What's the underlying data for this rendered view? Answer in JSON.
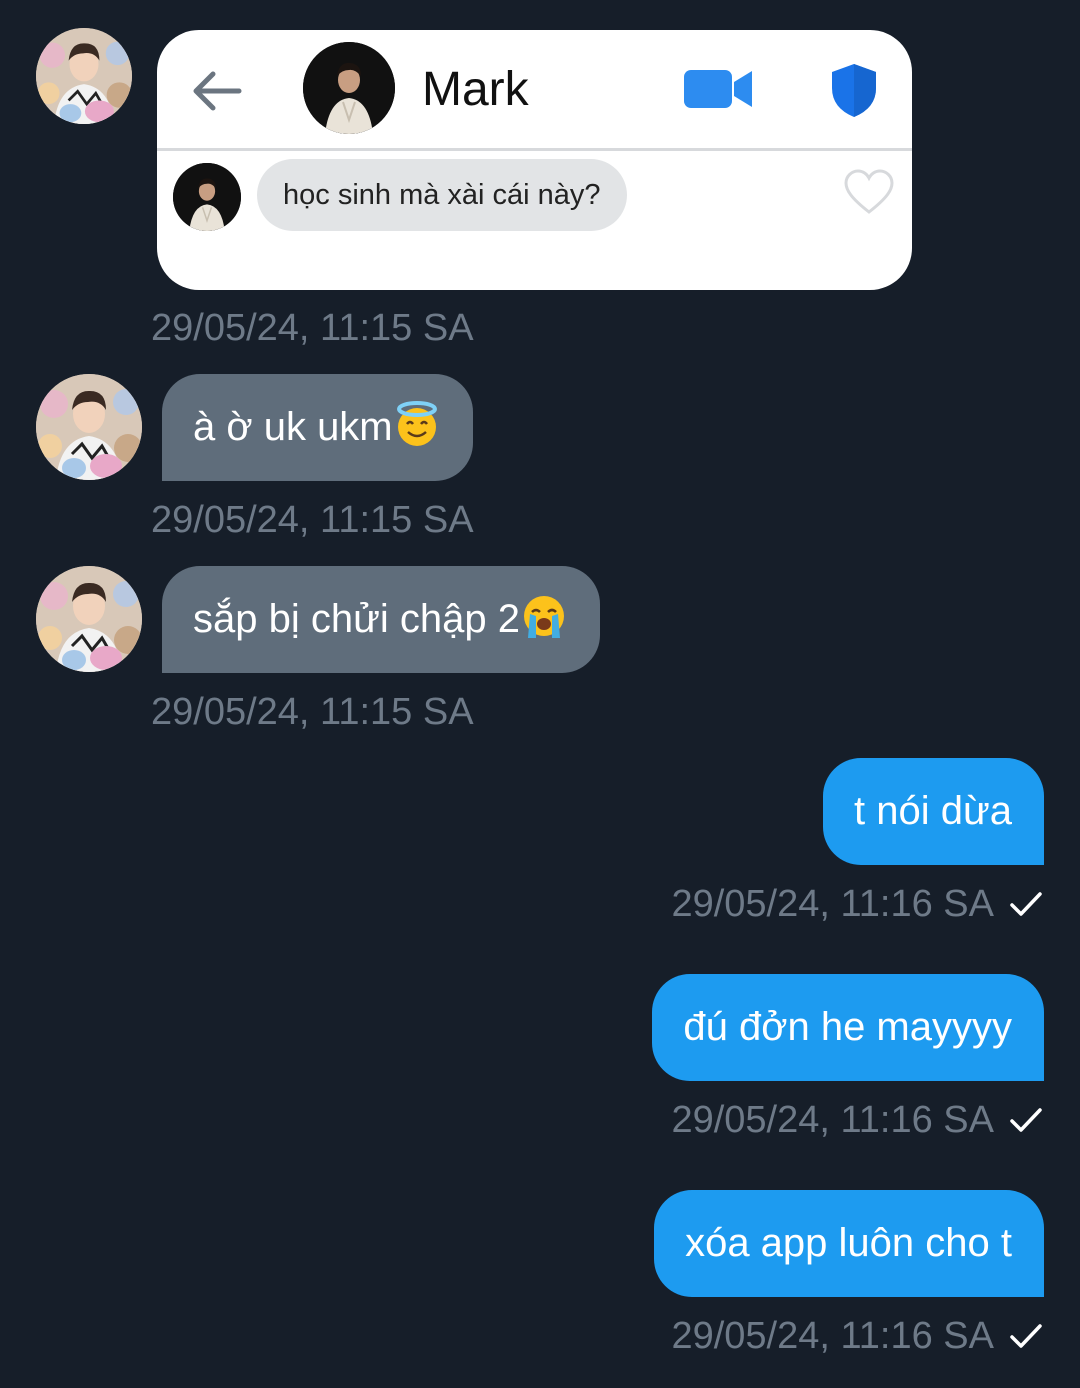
{
  "shared_screenshot": {
    "contact_name": "Mark",
    "message": "học sinh mà xài cái này?"
  },
  "messages": [
    {
      "direction": "incoming",
      "text": "29/05/24, 11:15 SA"
    },
    {
      "direction": "incoming",
      "text": "à ờ uk ukm",
      "emoji": "smiling-face-with-halo"
    },
    {
      "direction": "incoming",
      "text": "sắp bị chửi chập 2",
      "emoji": "loudly-crying-face"
    },
    {
      "direction": "outgoing",
      "text": "t nói dừa"
    },
    {
      "direction": "outgoing",
      "text": "đú đởn he mayyyy"
    },
    {
      "direction": "outgoing",
      "text": "xóa app luôn cho t"
    }
  ],
  "timestamps": {
    "t1": "29/05/24, 11:15 SA",
    "t2": "29/05/24, 11:15 SA",
    "t3": "29/05/24, 11:15 SA",
    "t4": "29/05/24, 11:16 SA",
    "t5": "29/05/24, 11:16 SA",
    "t6": "29/05/24, 11:16 SA"
  },
  "colors": {
    "background": "#161e29",
    "incoming_bubble": "#5f6d7b",
    "outgoing_bubble": "#1d9bf0",
    "timestamp": "#6e7a88",
    "icon_blue": "#1d9bf0"
  }
}
